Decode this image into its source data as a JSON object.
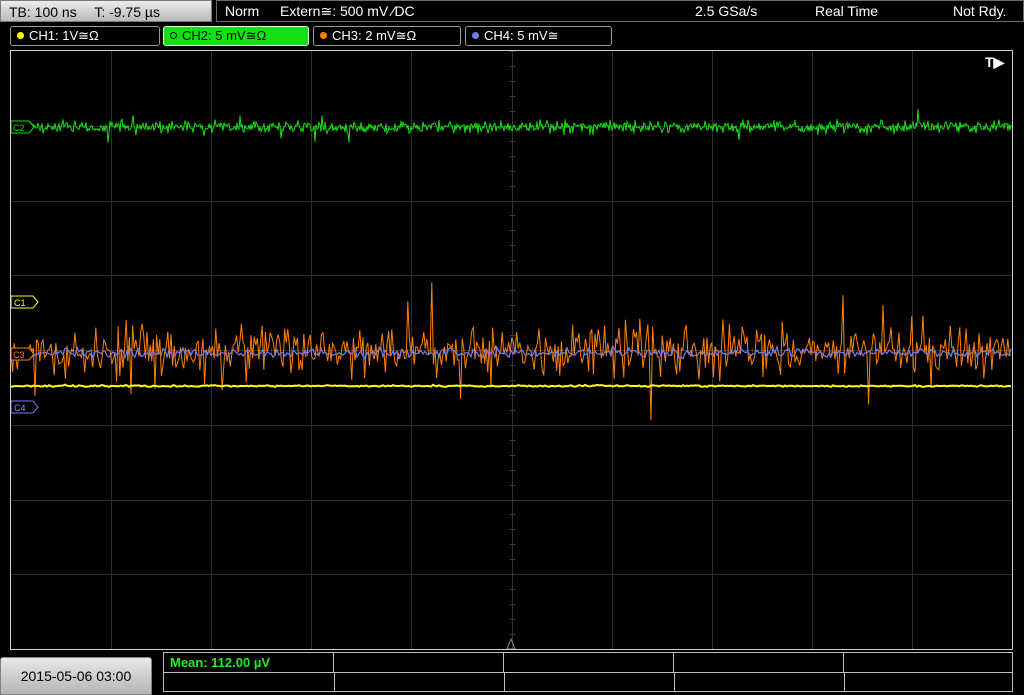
{
  "header": {
    "timebase": "TB: 100 ns",
    "trigger_time": "T: -9.75 µs",
    "trigger_mode": "Norm",
    "trigger_source": "Extern≅: 500 mV ⁄DC",
    "sample_rate": "2.5 GSa/s",
    "acq_mode": "Real Time",
    "status": "Not Rdy."
  },
  "channels": [
    {
      "label": "CH1: 1V≅Ω",
      "color": "#ffff00",
      "active": false
    },
    {
      "label": "CH2: 5 mV≅Ω",
      "color": "#12e012",
      "active": true
    },
    {
      "label": "CH3: 2 mV≅Ω",
      "color": "#ff8000",
      "active": false
    },
    {
      "label": "CH4: 5 mV≅",
      "color": "#7a7af0",
      "active": false
    }
  ],
  "markers": {
    "c1": "C1",
    "c4": "C4",
    "c2": "C2",
    "c3": "C3",
    "trigger": "T▶"
  },
  "footer": {
    "date": "2015-05-06 03:00",
    "mean": "Mean: 112.00 µV"
  },
  "colors": {
    "ch1": "#ffff00",
    "ch2": "#12e012",
    "ch3": "#ff8000",
    "ch4": "#7a7af0",
    "grid": "#2a2a2a"
  }
}
